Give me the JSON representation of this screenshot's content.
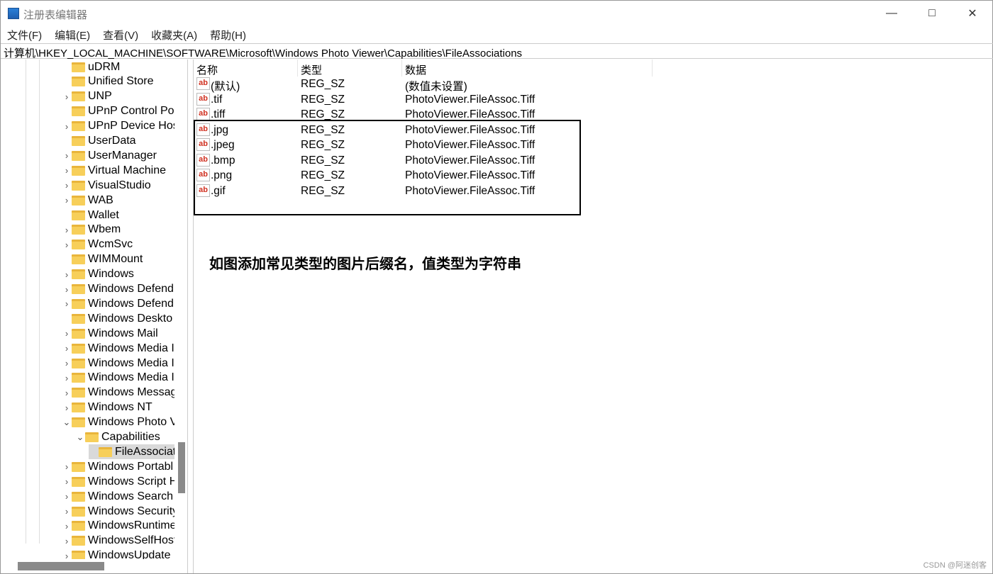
{
  "window": {
    "title": "注册表编辑器",
    "icon": "registry-editor-icon",
    "controls": [
      "minimize-icon",
      "maximize-icon",
      "close-icon"
    ]
  },
  "menu": [
    "文件(F)",
    "编辑(E)",
    "查看(V)",
    "收藏夹(A)",
    "帮助(H)"
  ],
  "address": "计算机\\HKEY_LOCAL_MACHINE\\SOFTWARE\\Microsoft\\Windows Photo Viewer\\Capabilities\\FileAssociations",
  "tree": [
    {
      "label": "uDRM",
      "expander": "none",
      "level": 0
    },
    {
      "label": "Unified Store",
      "expander": "none",
      "level": 0
    },
    {
      "label": "UNP",
      "expander": "collapsed",
      "level": 0
    },
    {
      "label": "UPnP Control Po",
      "expander": "none",
      "level": 0
    },
    {
      "label": "UPnP Device Hos",
      "expander": "collapsed",
      "level": 0
    },
    {
      "label": "UserData",
      "expander": "none",
      "level": 0
    },
    {
      "label": "UserManager",
      "expander": "collapsed",
      "level": 0
    },
    {
      "label": "Virtual Machine",
      "expander": "collapsed",
      "level": 0
    },
    {
      "label": "VisualStudio",
      "expander": "collapsed",
      "level": 0
    },
    {
      "label": "WAB",
      "expander": "collapsed",
      "level": 0
    },
    {
      "label": "Wallet",
      "expander": "none",
      "level": 0
    },
    {
      "label": "Wbem",
      "expander": "collapsed",
      "level": 0
    },
    {
      "label": "WcmSvc",
      "expander": "collapsed",
      "level": 0
    },
    {
      "label": "WIMMount",
      "expander": "none",
      "level": 0
    },
    {
      "label": "Windows",
      "expander": "collapsed",
      "level": 0
    },
    {
      "label": "Windows Defend",
      "expander": "collapsed",
      "level": 0
    },
    {
      "label": "Windows Defend",
      "expander": "collapsed",
      "level": 0
    },
    {
      "label": "Windows Deskto",
      "expander": "none",
      "level": 0
    },
    {
      "label": "Windows Mail",
      "expander": "collapsed",
      "level": 0
    },
    {
      "label": "Windows Media I",
      "expander": "collapsed",
      "level": 0
    },
    {
      "label": "Windows Media I",
      "expander": "collapsed",
      "level": 0
    },
    {
      "label": "Windows Media I",
      "expander": "collapsed",
      "level": 0
    },
    {
      "label": "Windows Messag",
      "expander": "collapsed",
      "level": 0
    },
    {
      "label": "Windows NT",
      "expander": "collapsed",
      "level": 0
    },
    {
      "label": "Windows Photo V",
      "expander": "expanded",
      "level": 0
    },
    {
      "label": "Capabilities",
      "expander": "expanded",
      "level": 1
    },
    {
      "label": "FileAssociat",
      "expander": "none",
      "level": 2,
      "selected": true
    },
    {
      "label": "Windows Portabl",
      "expander": "collapsed",
      "level": 0
    },
    {
      "label": "Windows Script H",
      "expander": "collapsed",
      "level": 0
    },
    {
      "label": "Windows Search",
      "expander": "collapsed",
      "level": 0
    },
    {
      "label": "Windows Security",
      "expander": "collapsed",
      "level": 0
    },
    {
      "label": "WindowsRuntime",
      "expander": "collapsed",
      "level": 0
    },
    {
      "label": "WindowsSelfHost",
      "expander": "collapsed",
      "level": 0
    },
    {
      "label": "WindowsUpdate",
      "expander": "collapsed",
      "level": 0
    }
  ],
  "columns": [
    "名称",
    "类型",
    "数据"
  ],
  "values": [
    {
      "name": "(默认)",
      "type": "REG_SZ",
      "data": "(数值未设置)"
    },
    {
      "name": ".tif",
      "type": "REG_SZ",
      "data": "PhotoViewer.FileAssoc.Tiff"
    },
    {
      "name": ".tiff",
      "type": "REG_SZ",
      "data": "PhotoViewer.FileAssoc.Tiff"
    },
    {
      "name": ".jpg",
      "type": "REG_SZ",
      "data": "PhotoViewer.FileAssoc.Tiff"
    },
    {
      "name": ".jpeg",
      "type": "REG_SZ",
      "data": "PhotoViewer.FileAssoc.Tiff"
    },
    {
      "name": ".bmp",
      "type": "REG_SZ",
      "data": "PhotoViewer.FileAssoc.Tiff"
    },
    {
      "name": ".png",
      "type": "REG_SZ",
      "data": "PhotoViewer.FileAssoc.Tiff"
    },
    {
      "name": ".gif",
      "type": "REG_SZ",
      "data": "PhotoViewer.FileAssoc.Tiff"
    }
  ],
  "string_value_icon": "ab",
  "annotation": "如图添加常见类型的图片后缀名，值类型为字符串",
  "watermark": "CSDN @阿迷创客"
}
